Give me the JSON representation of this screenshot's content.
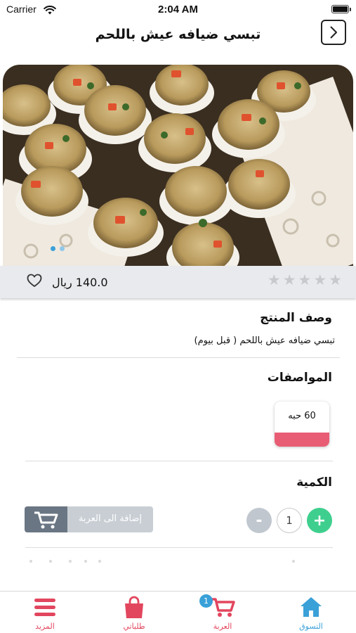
{
  "status_bar": {
    "carrier": "Carrier",
    "time": "2:04 AM"
  },
  "header": {
    "title": "تبسي ضيافه عيش باللحم"
  },
  "product": {
    "price": "140.0 ريال",
    "rating": 0,
    "rating_max": 5,
    "image_pages": 2,
    "image_page_active": 1
  },
  "description": {
    "title": "وصف المنتج",
    "text": "تبسي ضيافه عيش باللحم  ( قبل بيوم)"
  },
  "specs": {
    "title": "المواصفات",
    "options": [
      "60 حبه"
    ],
    "accent_color": "#e85d74"
  },
  "quantity": {
    "title": "الكمية",
    "value": "1",
    "plus": "+",
    "minus": "-",
    "add_to_cart": "إضافة الى العربة"
  },
  "tabs": [
    {
      "label": "التسوق",
      "icon": "home-icon"
    },
    {
      "label": "العربة",
      "icon": "cart-icon",
      "badge": "1"
    },
    {
      "label": "طلباتي",
      "icon": "shopping-bag-icon"
    },
    {
      "label": "المزيد",
      "icon": "menu-icon"
    }
  ],
  "colors": {
    "primary": "#e2465e",
    "accent": "#3aa0d8",
    "add_button": "#3ecf8e"
  }
}
